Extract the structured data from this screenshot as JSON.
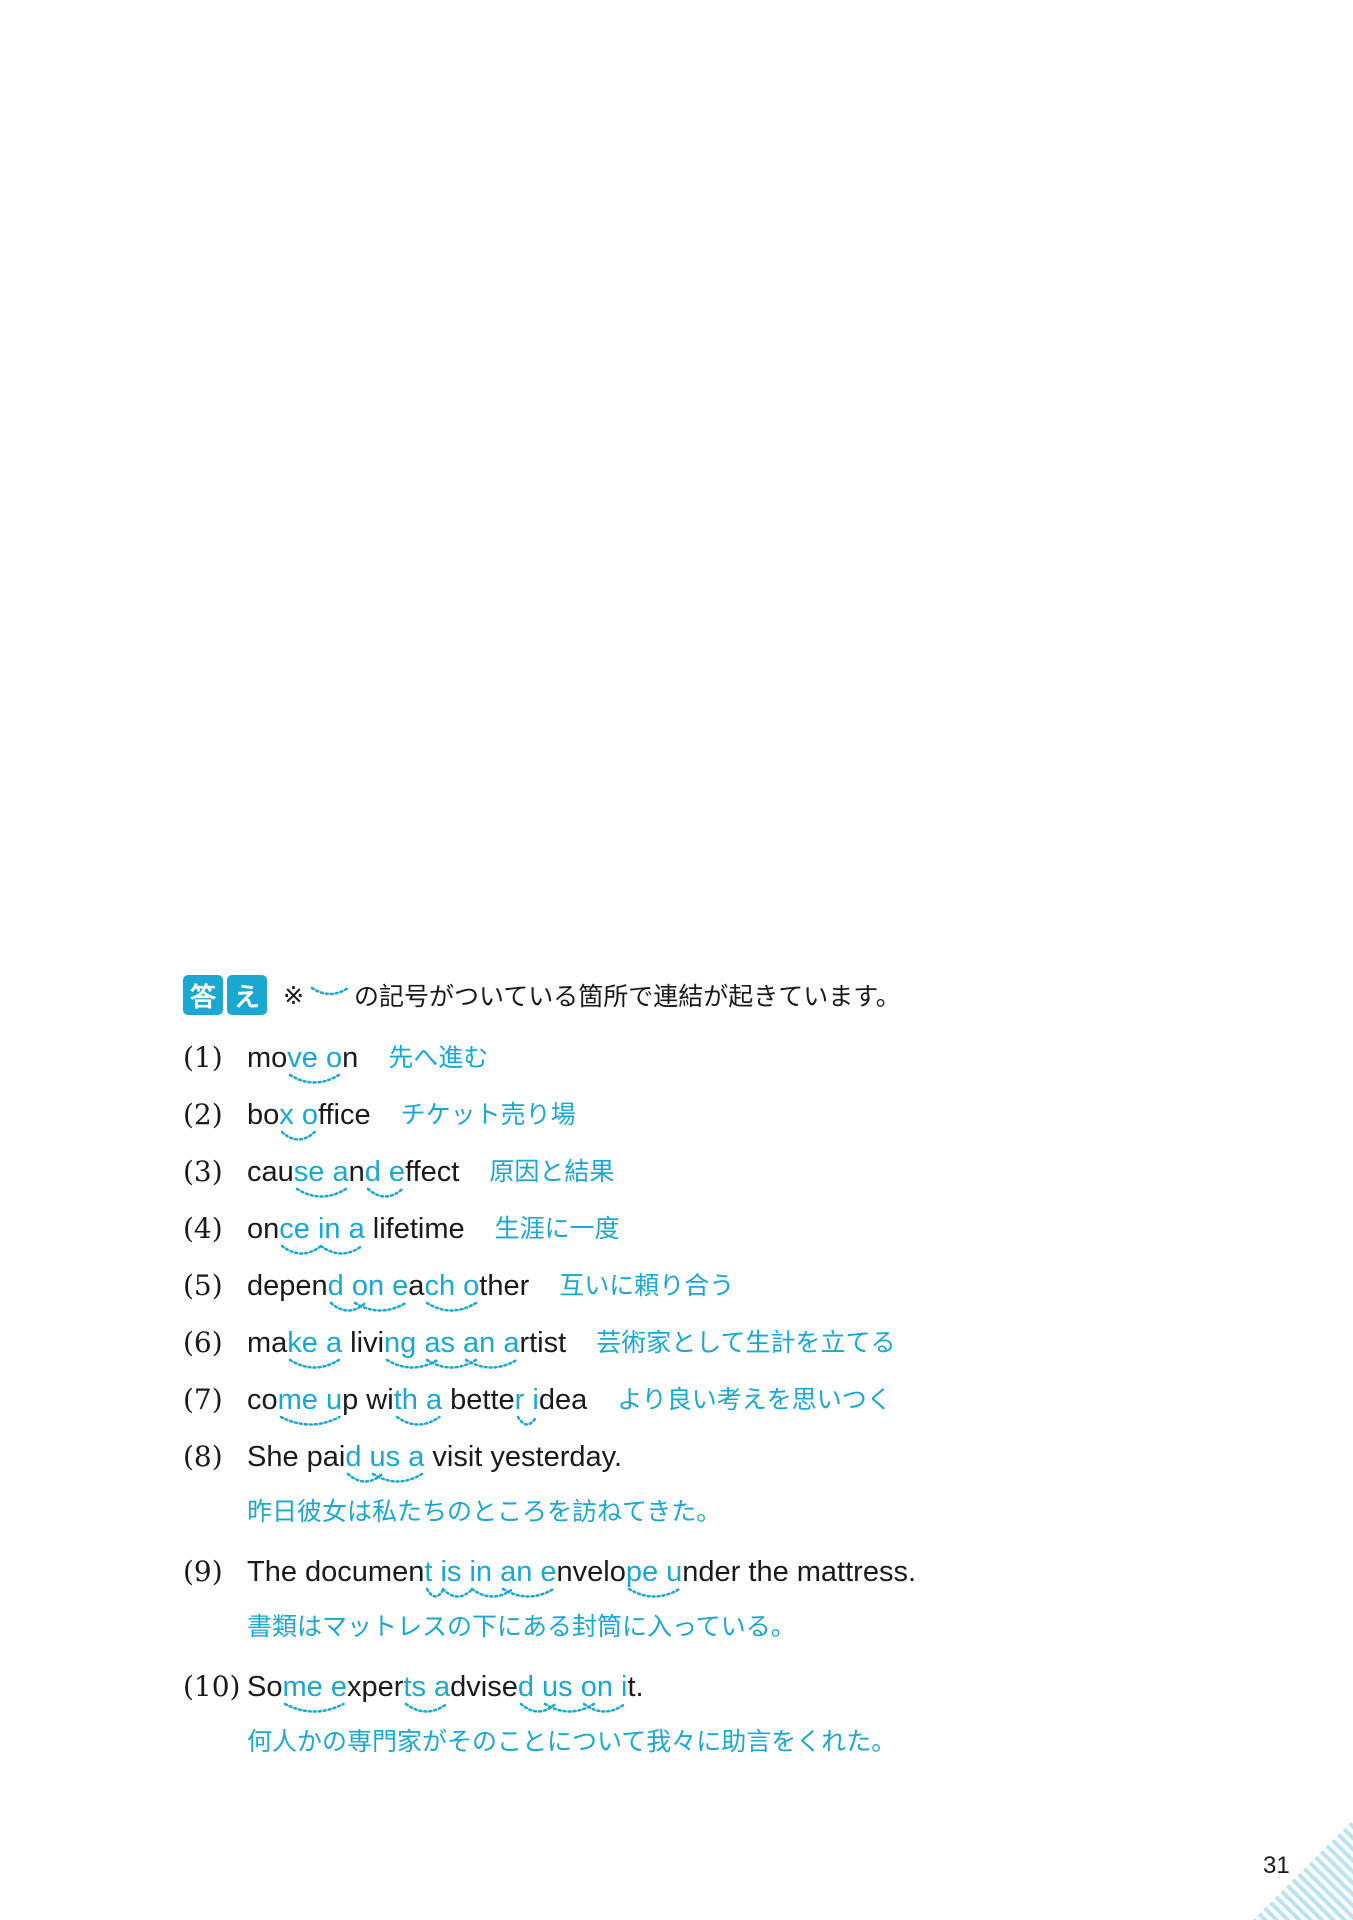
{
  "header": {
    "badge1": "答",
    "badge2": "え",
    "note_prefix": "※",
    "note_text": "の記号がついている箇所で連結が起きています。"
  },
  "entries": [
    {
      "num": "(1)",
      "segments": [
        [
          "mo",
          ""
        ],
        [
          "ve o",
          "b"
        ],
        [
          "n",
          ""
        ]
      ],
      "ja": "先へ進む"
    },
    {
      "num": "(2)",
      "segments": [
        [
          "bo",
          ""
        ],
        [
          "x o",
          "b"
        ],
        [
          "ffice",
          ""
        ]
      ],
      "ja": "チケット売り場"
    },
    {
      "num": "(3)",
      "segments": [
        [
          "cau",
          ""
        ],
        [
          "se a",
          "b"
        ],
        [
          "n",
          ""
        ],
        [
          "d e",
          "b"
        ],
        [
          "ffect",
          ""
        ]
      ],
      "ja": "原因と結果"
    },
    {
      "num": "(4)",
      "segments": [
        [
          "on",
          ""
        ],
        [
          "ce in a",
          "b"
        ],
        [
          " lifetime",
          ""
        ]
      ],
      "ja": "生涯に一度"
    },
    {
      "num": "(5)",
      "segments": [
        [
          "depen",
          ""
        ],
        [
          "d on e",
          "b"
        ],
        [
          "a",
          ""
        ],
        [
          "ch o",
          "b"
        ],
        [
          "ther",
          ""
        ]
      ],
      "ja": "互いに頼り合う"
    },
    {
      "num": "(6)",
      "segments": [
        [
          "ma",
          ""
        ],
        [
          "ke a",
          "b"
        ],
        [
          " livi",
          ""
        ],
        [
          "ng as an a",
          "b"
        ],
        [
          "rtist",
          ""
        ]
      ],
      "ja": "芸術家として生計を立てる"
    },
    {
      "num": "(7)",
      "segments": [
        [
          "co",
          ""
        ],
        [
          "me u",
          "b"
        ],
        [
          "p wi",
          ""
        ],
        [
          "th a",
          "b"
        ],
        [
          " bette",
          ""
        ],
        [
          "r i",
          "b"
        ],
        [
          "dea",
          ""
        ]
      ],
      "ja": "より良い考えを思いつく"
    },
    {
      "num": "(8)",
      "segments": [
        [
          "She pai",
          ""
        ],
        [
          "d us a",
          "b"
        ],
        [
          " visit yesterday.",
          ""
        ]
      ],
      "ja": "昨日彼女は私たちのところを訪ねてきた。"
    },
    {
      "num": "(9)",
      "segments": [
        [
          "The documen",
          ""
        ],
        [
          "t is in an e",
          "b"
        ],
        [
          "nvelo",
          ""
        ],
        [
          "pe u",
          "b"
        ],
        [
          "nder the mattress.",
          ""
        ]
      ],
      "ja": "書類はマットレスの下にある封筒に入っている。"
    },
    {
      "num": "(10)",
      "segments": [
        [
          "So",
          ""
        ],
        [
          "me e",
          "b"
        ],
        [
          "xper",
          ""
        ],
        [
          "ts a",
          "b"
        ],
        [
          "dvise",
          ""
        ],
        [
          "d us on i",
          "b"
        ],
        [
          "t.",
          ""
        ]
      ],
      "ja": "何人かの専門家がそのことについて我々に助言をくれた。"
    }
  ],
  "page_number": "31"
}
